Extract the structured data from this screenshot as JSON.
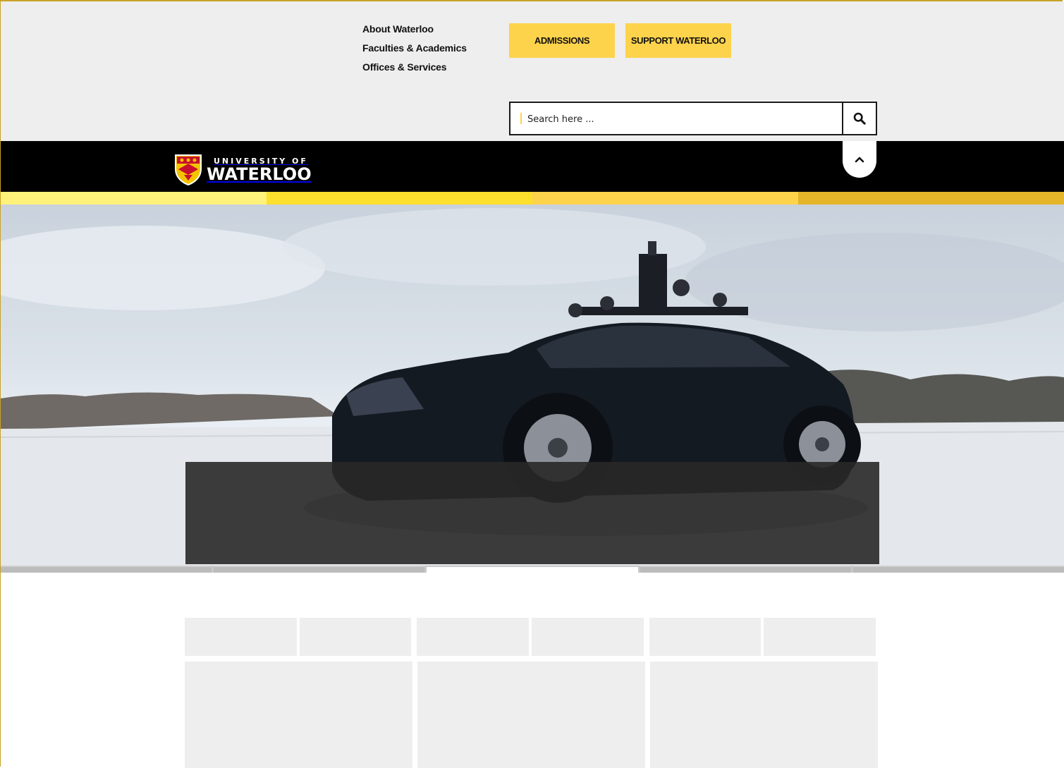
{
  "header": {
    "quick_links": [
      "About Waterloo",
      "Faculties & Academics",
      "Offices & Services"
    ],
    "admissions_label": "ADMISSIONS",
    "support_label": "SUPPORT WATERLOO",
    "search_placeholder": "Search here ..."
  },
  "brand": {
    "logo_small": "UNIVERSITY OF",
    "logo_big": "WATERLOO"
  },
  "icons": {
    "search": "search-icon",
    "collapse": "chevron-up-icon",
    "crest": "crest-icon"
  },
  "stripe_colors": [
    "#fff27a",
    "#fddf2e",
    "#fed34c",
    "#e4b429"
  ],
  "colors": {
    "accent": "#fed34c",
    "bar": "#000000",
    "panel": "#eeeeee"
  },
  "hero": {
    "slides": 5,
    "active_slide": 3
  }
}
